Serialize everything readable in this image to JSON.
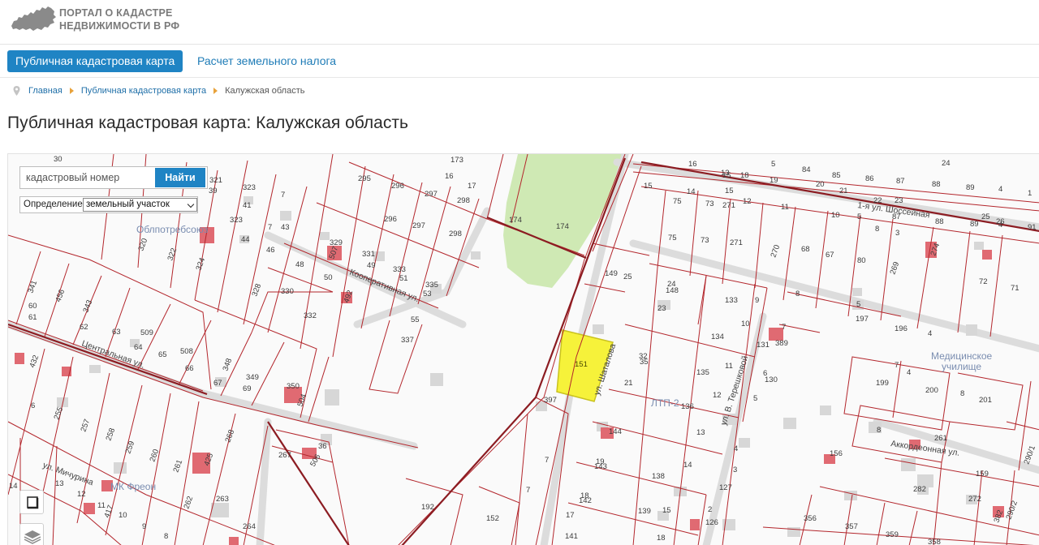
{
  "header": {
    "logo_line1": "ПОРТАЛ О КАДАСТРЕ",
    "logo_line2": "НЕДВИЖИМОСТИ В РФ"
  },
  "nav": {
    "tab_map": "Публичная кадастровая карта",
    "tab_tax": "Расчет земельного налога"
  },
  "breadcrumb": {
    "home": "Главная",
    "map": "Публичная кадастровая карта",
    "current": "Калужская область"
  },
  "page_title": "Публичная кадастровая карта: Калужская область",
  "search": {
    "placeholder": "кадастровый номер",
    "button": "Найти"
  },
  "definition": {
    "label": "Определение:",
    "selected": "земельный участок"
  },
  "map": {
    "highlighted_parcel": "151",
    "colors": {
      "parcel_border": "#b3262c",
      "highlight_fill": "#f6f23a",
      "park_fill": "#cfe9b4",
      "building_fill": "#d7d7d7",
      "owned_building_fill": "#e06a72",
      "background": "#fafafa"
    },
    "street_labels": [
      "Кооперативная ул.",
      "Центральная ул.",
      "ул. Мичурина",
      "ул. Шаталова",
      "ул. В. Терешковой",
      "1-я ул. Шоссейная",
      "Аккордеонная ул."
    ],
    "place_labels": [
      "Облпотребсоюз",
      "МК Фреон",
      "ЛТП-2",
      "Медицинское училище"
    ],
    "parcel_numbers": [
      "30",
      "321",
      "39",
      "323",
      "41",
      "323",
      "7",
      "44",
      "43",
      "46",
      "48",
      "50",
      "295",
      "296",
      "297",
      "298",
      "296",
      "297",
      "298",
      "16",
      "17",
      "173",
      "174",
      "174",
      "329",
      "507",
      "331",
      "49",
      "333",
      "51",
      "335",
      "53",
      "320",
      "322",
      "324",
      "328",
      "330",
      "332",
      "341",
      "60",
      "456",
      "61",
      "343",
      "62",
      "63",
      "509",
      "64",
      "65",
      "508",
      "66",
      "348",
      "67",
      "349",
      "69",
      "350",
      "504",
      "55",
      "337",
      "192",
      "432",
      "6",
      "255",
      "257",
      "258",
      "259",
      "260",
      "261",
      "262",
      "263",
      "264",
      "267",
      "36",
      "506",
      "425",
      "268",
      "14",
      "13",
      "12",
      "11",
      "10",
      "9",
      "8",
      "4",
      "5",
      "397",
      "7",
      "7",
      "149",
      "25",
      "148",
      "24",
      "23",
      "133",
      "9",
      "134",
      "10",
      "131",
      "389",
      "151",
      "32",
      "35",
      "21",
      "135",
      "11",
      "130",
      "136",
      "144",
      "19",
      "143",
      "138",
      "18",
      "142",
      "17",
      "139",
      "15",
      "141",
      "14",
      "126",
      "127",
      "2",
      "152",
      "75",
      "73",
      "271",
      "270",
      "68",
      "67",
      "80",
      "269",
      "274",
      "75",
      "73",
      "271",
      "72",
      "71",
      "197",
      "196",
      "199",
      "200",
      "201",
      "8",
      "261",
      "156",
      "282",
      "272",
      "159",
      "356",
      "357",
      "359",
      "358",
      "290/1",
      "290/2",
      "382",
      "4",
      "5",
      "6",
      "3",
      "12",
      "13",
      "15",
      "18",
      "19",
      "84",
      "85",
      "86",
      "87",
      "88",
      "89",
      "1",
      "4",
      "21",
      "22",
      "23",
      "24",
      "25",
      "26",
      "91",
      "87",
      "88",
      "89",
      "20",
      "16",
      "17",
      "10",
      "5",
      "8",
      "3"
    ]
  }
}
